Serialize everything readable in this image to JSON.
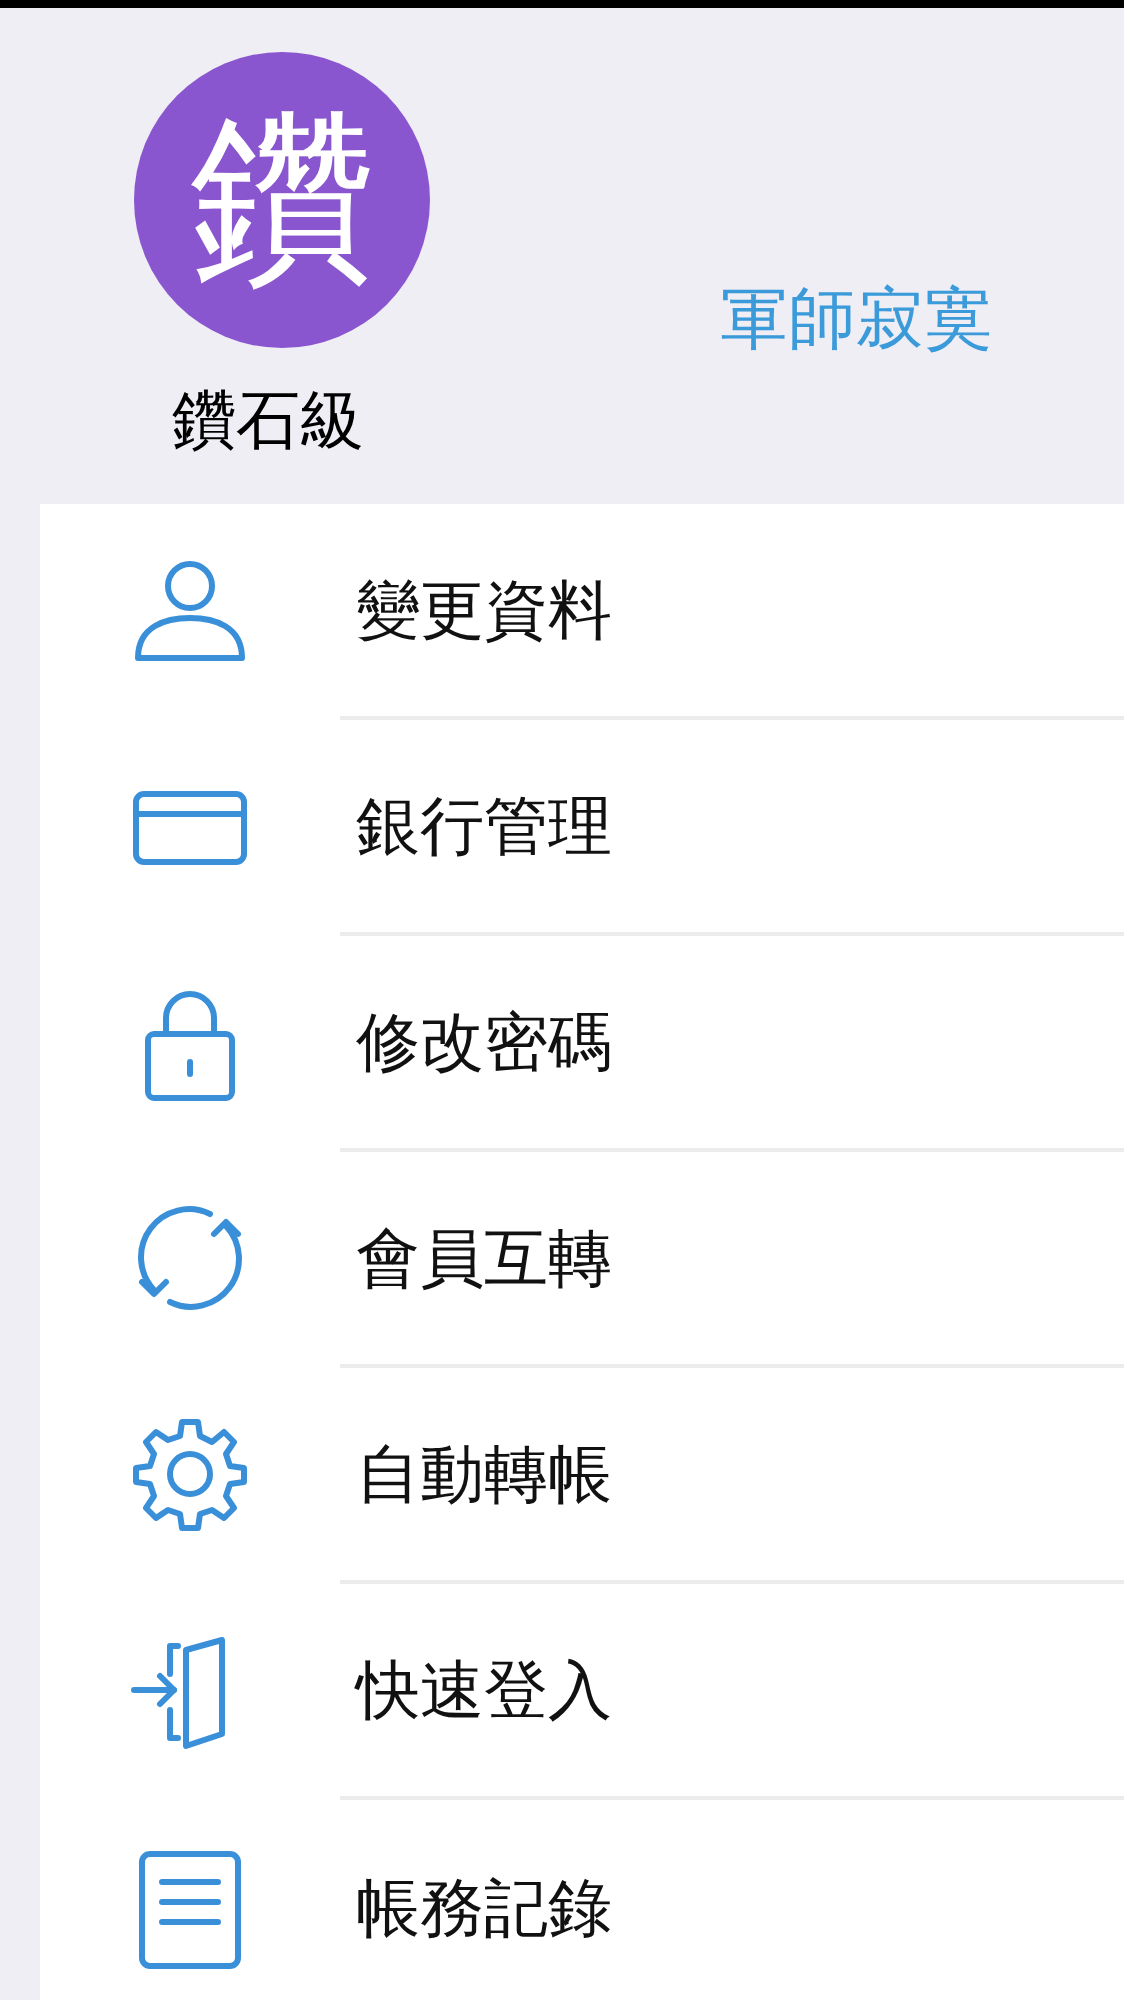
{
  "profile": {
    "avatar_text": "鑽",
    "level": "鑽石級",
    "nickname": "軍師寂寞"
  },
  "menu": [
    {
      "label": "變更資料"
    },
    {
      "label": "銀行管理"
    },
    {
      "label": "修改密碼"
    },
    {
      "label": "會員互轉"
    },
    {
      "label": "自動轉帳"
    },
    {
      "label": "快速登入"
    },
    {
      "label": "帳務記錄"
    }
  ]
}
